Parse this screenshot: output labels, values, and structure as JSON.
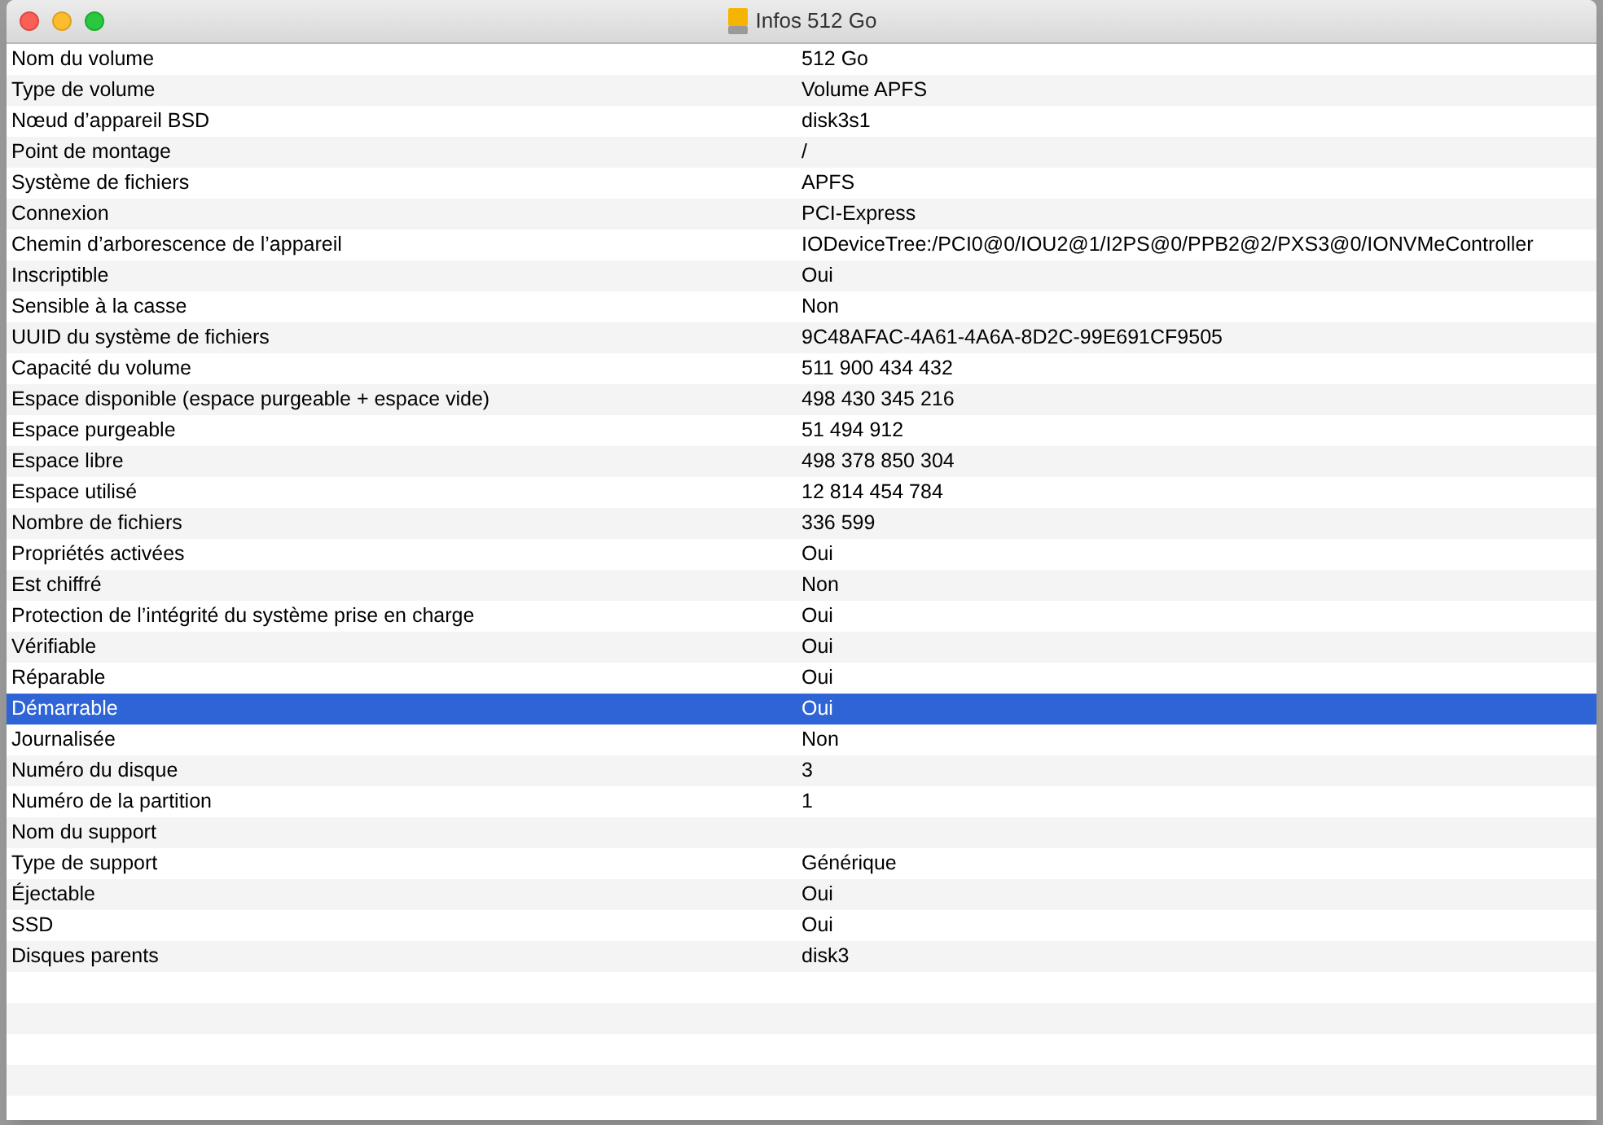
{
  "window": {
    "title": "Infos 512 Go"
  },
  "rows": [
    {
      "label": "Nom du volume",
      "value": "512 Go",
      "selected": false
    },
    {
      "label": "Type de volume",
      "value": "Volume APFS",
      "selected": false
    },
    {
      "label": "Nœud d’appareil BSD",
      "value": "disk3s1",
      "selected": false
    },
    {
      "label": "Point de montage",
      "value": "/",
      "selected": false
    },
    {
      "label": "Système de fichiers",
      "value": "APFS",
      "selected": false
    },
    {
      "label": "Connexion",
      "value": "PCI-Express",
      "selected": false
    },
    {
      "label": "Chemin d’arborescence de l’appareil",
      "value": "IODeviceTree:/PCI0@0/IOU2@1/I2PS@0/PPB2@2/PXS3@0/IONVMeController",
      "selected": false
    },
    {
      "label": "Inscriptible",
      "value": "Oui",
      "selected": false
    },
    {
      "label": "Sensible à la casse",
      "value": "Non",
      "selected": false
    },
    {
      "label": "UUID du système de fichiers",
      "value": "9C48AFAC-4A61-4A6A-8D2C-99E691CF9505",
      "selected": false
    },
    {
      "label": "Capacité du volume",
      "value": "511 900 434 432",
      "selected": false
    },
    {
      "label": "Espace disponible (espace purgeable + espace vide)",
      "value": "498 430 345 216",
      "selected": false
    },
    {
      "label": "Espace purgeable",
      "value": "51 494 912",
      "selected": false
    },
    {
      "label": "Espace libre",
      "value": "498 378 850 304",
      "selected": false
    },
    {
      "label": "Espace utilisé",
      "value": "12 814 454 784",
      "selected": false
    },
    {
      "label": "Nombre de fichiers",
      "value": "336 599",
      "selected": false
    },
    {
      "label": "Propriétés activées",
      "value": "Oui",
      "selected": false
    },
    {
      "label": "Est chiffré",
      "value": "Non",
      "selected": false
    },
    {
      "label": "Protection de l’intégrité du système prise en charge",
      "value": "Oui",
      "selected": false
    },
    {
      "label": "Vérifiable",
      "value": "Oui",
      "selected": false
    },
    {
      "label": "Réparable",
      "value": "Oui",
      "selected": false
    },
    {
      "label": "Démarrable",
      "value": "Oui",
      "selected": true
    },
    {
      "label": "Journalisée",
      "value": "Non",
      "selected": false
    },
    {
      "label": "Numéro du disque",
      "value": "3",
      "selected": false
    },
    {
      "label": "Numéro de la partition",
      "value": "1",
      "selected": false
    },
    {
      "label": "Nom du support",
      "selected": false
    },
    {
      "label": "Type de support",
      "value": "Générique",
      "selected": false
    },
    {
      "label": "Éjectable",
      "value": "Oui",
      "selected": false
    },
    {
      "label": "SSD",
      "value": "Oui",
      "selected": false
    },
    {
      "label": "Disques parents",
      "value": "disk3",
      "selected": false
    }
  ]
}
